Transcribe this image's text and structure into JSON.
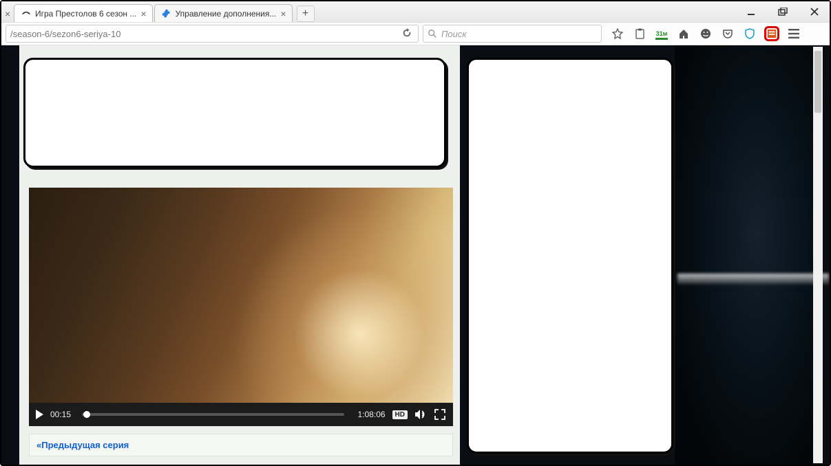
{
  "window": {
    "tabs": [
      {
        "title": "Игра Престолов 6 сезон ..."
      },
      {
        "title": "Управление дополнения..."
      }
    ]
  },
  "navbar": {
    "url_fragment": "/season-6/sezon6-seriya-10",
    "search_placeholder": "Поиск",
    "savefrom_label": "31м"
  },
  "player": {
    "elapsed": "00:15",
    "total": "1:08:06",
    "hd_label": "HD"
  },
  "nav_links": {
    "prev_episode": "«Предыдущая серия"
  }
}
